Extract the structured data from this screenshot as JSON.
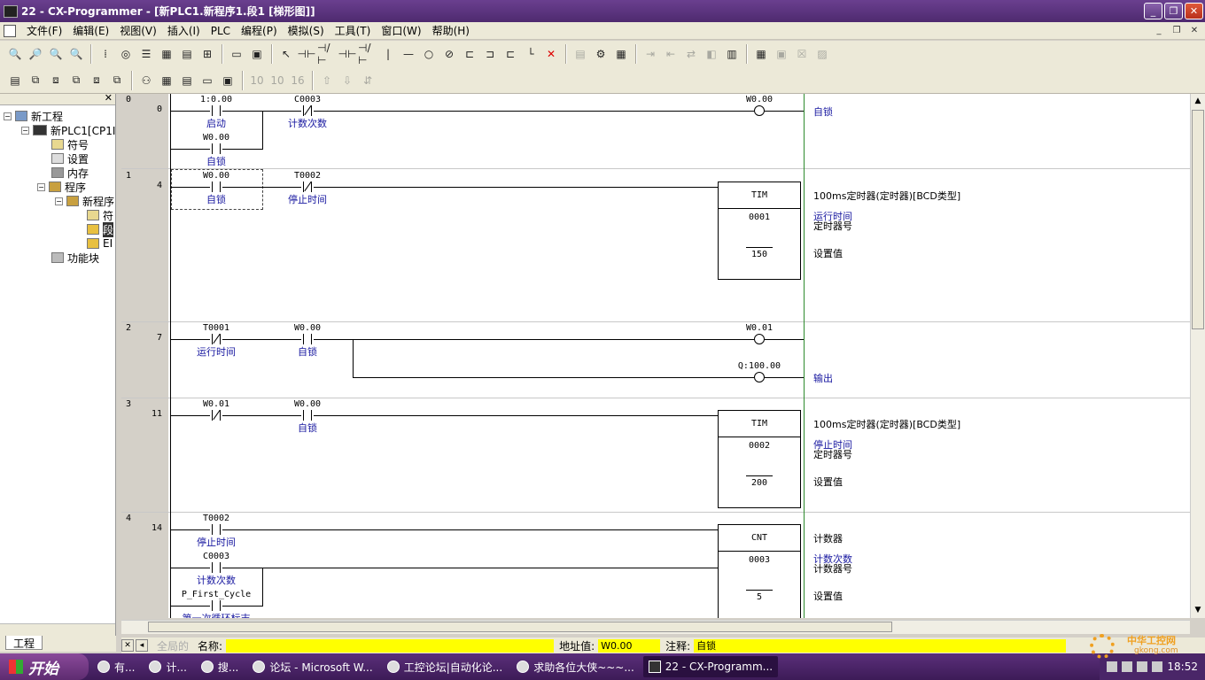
{
  "window": {
    "title": "22 - CX-Programmer - [新PLC1.新程序1.段1 [梯形图]]"
  },
  "menu": [
    "文件(F)",
    "编辑(E)",
    "视图(V)",
    "插入(I)",
    "PLC",
    "编程(P)",
    "模拟(S)",
    "工具(T)",
    "窗口(W)",
    "帮助(H)"
  ],
  "tree": {
    "items": [
      {
        "label": "新工程",
        "icon": "project-icon"
      },
      {
        "label": "新PLC1[CP1I",
        "icon": "plc-icon"
      },
      {
        "label": "符号",
        "icon": "symbol-icon"
      },
      {
        "label": "设置",
        "icon": "settings-icon"
      },
      {
        "label": "内存",
        "icon": "memory-icon"
      },
      {
        "label": "程序",
        "icon": "programs-icon"
      },
      {
        "label": "新程序",
        "icon": "program-icon"
      },
      {
        "label": "符",
        "icon": "symbol-icon"
      },
      {
        "label": "段",
        "icon": "section-icon"
      },
      {
        "label": "EI",
        "icon": "end-icon"
      },
      {
        "label": "功能块",
        "icon": "function-block-icon"
      }
    ],
    "tab": "工程"
  },
  "ladder": {
    "rungs": [
      {
        "rung": "0",
        "step": "0"
      },
      {
        "rung": "1",
        "step": "4"
      },
      {
        "rung": "2",
        "step": "7"
      },
      {
        "rung": "3",
        "step": "11"
      },
      {
        "rung": "4",
        "step": "14"
      }
    ],
    "contacts": [
      {
        "addr": "1:0.00",
        "label": "启动"
      },
      {
        "addr": "W0.00",
        "label": "自锁"
      },
      {
        "addr": "C0003",
        "label": "计数次数"
      },
      {
        "addr": "W0.00",
        "label": "自锁"
      },
      {
        "addr": "T0002",
        "label": "停止时间"
      },
      {
        "addr": "T0001",
        "label": "运行时间"
      },
      {
        "addr": "W0.00",
        "label": "自锁"
      },
      {
        "addr": "W0.01",
        "label": ""
      },
      {
        "addr": "W0.00",
        "label": "自锁"
      },
      {
        "addr": "T0002",
        "label": "停止时间"
      },
      {
        "addr": "C0003",
        "label": "计数次数"
      },
      {
        "addr": "P_First_Cycle",
        "label": "第一次循环标志"
      }
    ],
    "coils": [
      {
        "addr": "W0.00",
        "comment": "自锁"
      },
      {
        "addr": "W0.01",
        "comment": ""
      },
      {
        "addr": "Q:100.00",
        "comment": "输出"
      }
    ],
    "blocks": [
      {
        "type": "TIM",
        "number": "0001",
        "set": "150",
        "comment": "100ms定时器(定时器)[BCD类型]",
        "num_label": "运行时间",
        "num_desc": "定时器号",
        "set_desc": "设置值"
      },
      {
        "type": "TIM",
        "number": "0002",
        "set": "200",
        "comment": "100ms定时器(定时器)[BCD类型]",
        "num_label": "停止时间",
        "num_desc": "定时器号",
        "set_desc": "设置值"
      },
      {
        "type": "CNT",
        "number": "0003",
        "set": "5",
        "comment": "计数器",
        "num_label": "计数次数",
        "num_desc": "计数器号",
        "set_desc": "设置值"
      }
    ]
  },
  "status": {
    "global": "全局的",
    "name_label": "名称:",
    "name_value": "",
    "addr_label": "地址值:",
    "addr_value": "W0.00",
    "comment_label": "注释:",
    "comment_value": "自锁"
  },
  "taskbar": {
    "start": "开始",
    "items": [
      "有...",
      "计...",
      "搜...",
      "论坛 - Microsoft W...",
      "工控论坛|自动化论...",
      "求助各位大侠~~~...",
      "22 - CX-Programm..."
    ],
    "clock": "18:52"
  },
  "watermark": {
    "line1": "中华工控网",
    "line2": "gkong.com"
  }
}
